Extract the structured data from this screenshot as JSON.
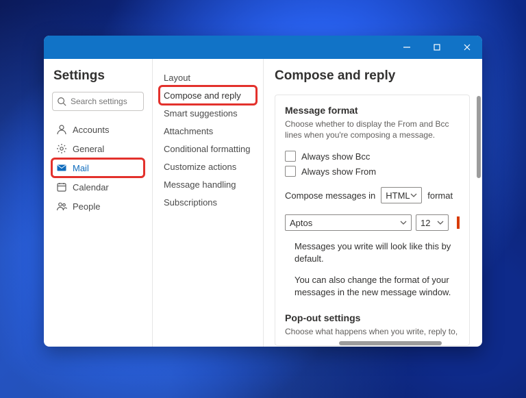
{
  "window": {
    "titlebar_color": "#1173c7"
  },
  "sidebar": {
    "title": "Settings",
    "search_placeholder": "Search settings",
    "items": [
      {
        "icon": "person",
        "label": "Accounts"
      },
      {
        "icon": "gear",
        "label": "General"
      },
      {
        "icon": "mail",
        "label": "Mail",
        "selected": true
      },
      {
        "icon": "calendar",
        "label": "Calendar"
      },
      {
        "icon": "people",
        "label": "People"
      }
    ]
  },
  "subnav": {
    "items": [
      {
        "label": "Layout"
      },
      {
        "label": "Compose and reply",
        "selected": true
      },
      {
        "label": "Smart suggestions"
      },
      {
        "label": "Attachments"
      },
      {
        "label": "Conditional formatting"
      },
      {
        "label": "Customize actions"
      },
      {
        "label": "Message handling"
      },
      {
        "label": "Subscriptions"
      }
    ]
  },
  "panel": {
    "title": "Compose and reply",
    "message_format": {
      "heading": "Message format",
      "description": "Choose whether to display the From and Bcc lines when you're composing a message.",
      "bcc_label": "Always show Bcc",
      "from_label": "Always show From",
      "compose_prefix": "Compose messages in",
      "compose_format_value": "HTML",
      "compose_suffix": "format",
      "font_value": "Aptos",
      "size_value": "12",
      "preview_line1": "Messages you write will look like this by default.",
      "preview_line2": "You can also change the format of your messages in the new message window."
    },
    "popout": {
      "heading": "Pop-out settings",
      "description": "Choose what happens when you write, reply to,"
    }
  },
  "chart_data": null
}
